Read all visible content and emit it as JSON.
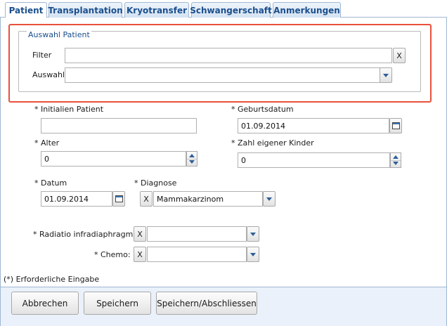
{
  "tabs": [
    {
      "label": "Patient",
      "active": true
    },
    {
      "label": "Transplantation"
    },
    {
      "label": "Kryotransfer"
    },
    {
      "label": "Schwangerschaft"
    },
    {
      "label": "Anmerkungen"
    }
  ],
  "auswahl": {
    "legend": "Auswahl Patient",
    "filter_label": "Filter",
    "filter_value": "",
    "filter_clear": "X",
    "auswahl_label": "Auswahl",
    "auswahl_value": ""
  },
  "form": {
    "initialen_label": "* Initialien Patient",
    "initialen_value": "",
    "geburtsdatum_label": "* Geburtsdatum",
    "geburtsdatum_value": "01.09.2014",
    "alter_label": "* Alter",
    "alter_value": "0",
    "kinder_label": "* Zahl eigener Kinder",
    "kinder_value": "0",
    "datum_label": "* Datum",
    "datum_value": "01.09.2014",
    "diagnose_label": "* Diagnose",
    "diagnose_clear": "X",
    "diagnose_value": "Mammakarzinom",
    "radiatio_label": "* Radiatio infradiaphragmal:",
    "radiatio_clear": "X",
    "radiatio_value": "",
    "chemo_label": "* Chemo:",
    "chemo_clear": "X",
    "chemo_value": "",
    "required_note": "(*) Erforderliche Eingabe"
  },
  "buttons": {
    "abbrechen": "Abbrechen",
    "speichern": "Speichern",
    "speichern_abschliessen": "Speichern/Abschliessen"
  },
  "colors": {
    "tab_text": "#1b4f8d",
    "highlight_border": "#e8513a",
    "footer_bg": "#eaf1fa"
  }
}
